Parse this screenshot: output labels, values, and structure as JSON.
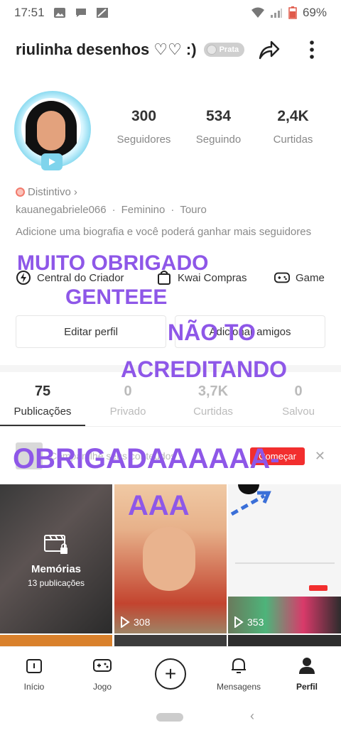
{
  "status_bar": {
    "time": "17:51",
    "battery": "69%"
  },
  "header": {
    "username": "riulinha desenhos ♡♡ :)",
    "badge": "Prata"
  },
  "stats": [
    {
      "value": "300",
      "label": "Seguidores"
    },
    {
      "value": "534",
      "label": "Seguindo"
    },
    {
      "value": "2,4K",
      "label": "Curtidas"
    }
  ],
  "profile": {
    "distintivo": "Distintivo",
    "handle": "kauanegabriele066",
    "gender": "Feminino",
    "sign": "Touro",
    "bio": "Adicione uma biografia e você poderá ganhar mais seguidores"
  },
  "links": {
    "creator": "Central do Criador",
    "shop": "Kwai Compras",
    "game": "Game"
  },
  "buttons": {
    "edit": "Editar perfil",
    "add_friends": "Adicionar amigos"
  },
  "tabs": [
    {
      "count": "75",
      "label": "Publicações"
    },
    {
      "count": "0",
      "label": "Privado"
    },
    {
      "count": "3,7K",
      "label": "Curtidas"
    },
    {
      "count": "0",
      "label": "Salvou"
    }
  ],
  "promo": {
    "text": "Compartilhe seus conteúdos",
    "button": "Começar"
  },
  "grid": {
    "memories_title": "Memórias",
    "memories_sub": "13 publicações",
    "video2_views": "308",
    "video3_views": "353"
  },
  "nav": {
    "inicio": "Início",
    "jogo": "Jogo",
    "mensagens": "Mensagens",
    "perfil": "Perfil"
  },
  "overlay": {
    "line1": "MUITO OBRIGADO",
    "line2": "GENTEEE",
    "line3": "NÃO TO",
    "line4": "ACREDITANDO",
    "line5": "OBRIGADAAAAAA-",
    "line6": "AAA",
    "color": "#8e57e8"
  }
}
